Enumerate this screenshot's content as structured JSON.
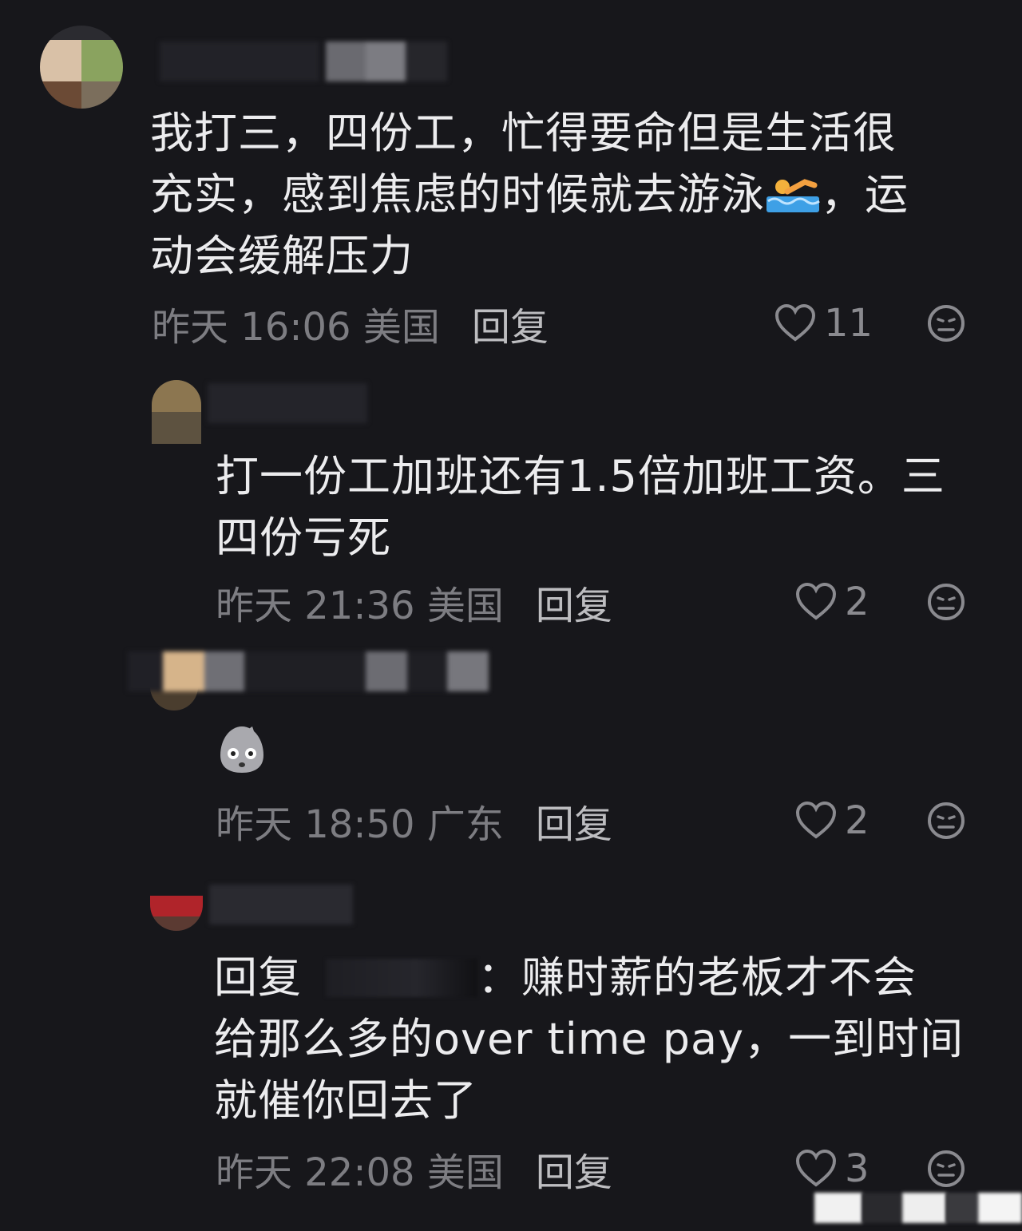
{
  "comments": [
    {
      "text_lines": [
        "我打三，四份工，忙得要命但是生活很",
        "充实，感到焦虑的时候就去游泳",
        "，运",
        "动会缓解压力"
      ],
      "time": "昨天 16:06 美国",
      "reply_label": "回复",
      "likes": "11"
    },
    {
      "text_lines": [
        "打一份工加班还有1.5倍加班工资。三",
        "四份亏死"
      ],
      "time": "昨天 21:36 美国",
      "reply_label": "回复",
      "likes": "2"
    },
    {
      "time": "昨天 18:50 广东",
      "reply_label": "回复",
      "likes": "2"
    },
    {
      "reply_prefix": "回复",
      "text_lines": [
        "：赚时薪的老板才不会",
        "给那么多的over time pay，一到时间",
        "就催你回去了"
      ],
      "time": "昨天 22:08 美国",
      "reply_label": "回复",
      "likes": "3"
    }
  ],
  "icons": {
    "like": "heart-icon",
    "react": "neutral-face-icon",
    "swim": "swimmer-emoji",
    "sticker": "shocked-sticker"
  },
  "colors": {
    "background": "#17171b",
    "text": "#ececee",
    "meta": "#7d7d82"
  }
}
